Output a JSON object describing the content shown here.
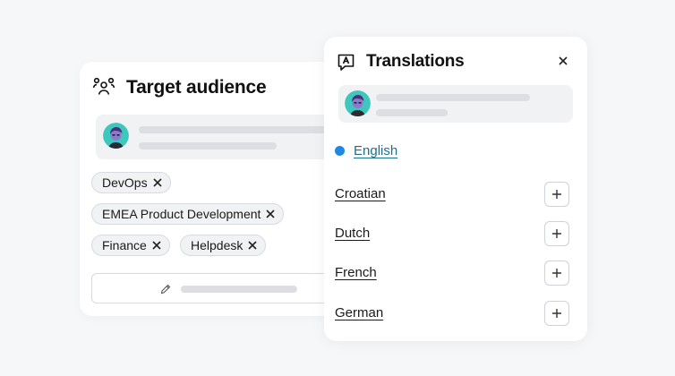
{
  "audience": {
    "title": "Target audience",
    "tags": [
      "DevOps",
      "EMEA Product Development",
      "Finance",
      "Helpdesk"
    ]
  },
  "translations": {
    "title": "Translations",
    "active_language": "English",
    "languages": [
      "Croatian",
      "Dutch",
      "French",
      "German"
    ]
  },
  "colors": {
    "active_dot": "#1e88e5",
    "link": "#1f6e8c"
  }
}
